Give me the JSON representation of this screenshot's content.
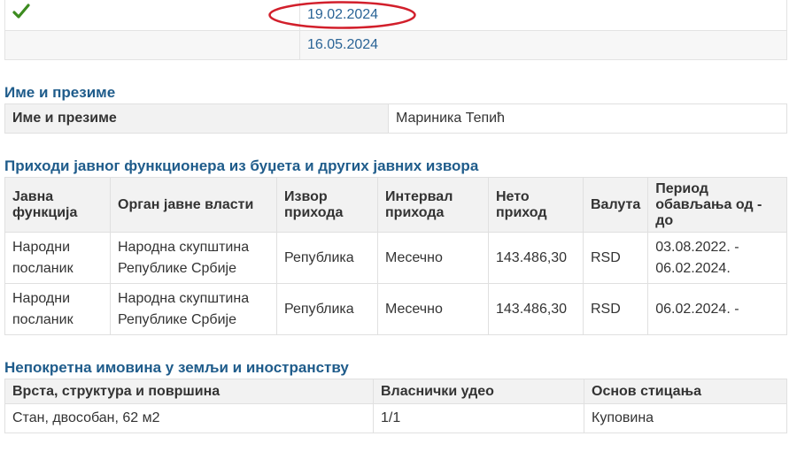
{
  "reports": {
    "rows": [
      {
        "checked": true,
        "date": "19.02.2024",
        "highlighted": true
      },
      {
        "checked": false,
        "date": "16.05.2024",
        "highlighted": false
      }
    ]
  },
  "name_section": {
    "title": "Име и презиме",
    "label": "Име и презиме",
    "value": "Мариника Тепић"
  },
  "income_section": {
    "title": "Приходи јавног функционера из буџета и других јавних извора",
    "headers": {
      "function": "Јавна функција",
      "authority": "Орган јавне власти",
      "source": "Извор прихода",
      "interval": "Интервал прихода",
      "net": "Нето приход",
      "currency": "Валута",
      "period": "Период обављања од - до"
    },
    "rows": [
      {
        "function": "Народни посланик",
        "authority": "Народна скупштина Републике Србије",
        "source": "Република",
        "interval": "Месечно",
        "net": "143.486,30",
        "currency": "RSD",
        "period": "03.08.2022. - 06.02.2024."
      },
      {
        "function": "Народни посланик",
        "authority": "Народна скупштина Републике Србије",
        "source": "Република",
        "interval": "Месечно",
        "net": "143.486,30",
        "currency": "RSD",
        "period": "06.02.2024. -"
      }
    ]
  },
  "property_section": {
    "title": "Непокретна имовина у земљи и иностранству",
    "headers": {
      "type": "Врста, структура и површина",
      "share": "Власнички удео",
      "basis": "Основ стицања"
    },
    "rows": [
      {
        "type": "Стан, двособан, 62 м2",
        "share": "1/1",
        "basis": "Куповина"
      }
    ]
  },
  "colors": {
    "link": "#2a6496",
    "section_title": "#1f5c8b",
    "check": "#3c8b1f",
    "highlight_ellipse": "#d21f2b",
    "header_bg": "#f2f2f2"
  },
  "icons": {
    "check": "check-icon"
  }
}
